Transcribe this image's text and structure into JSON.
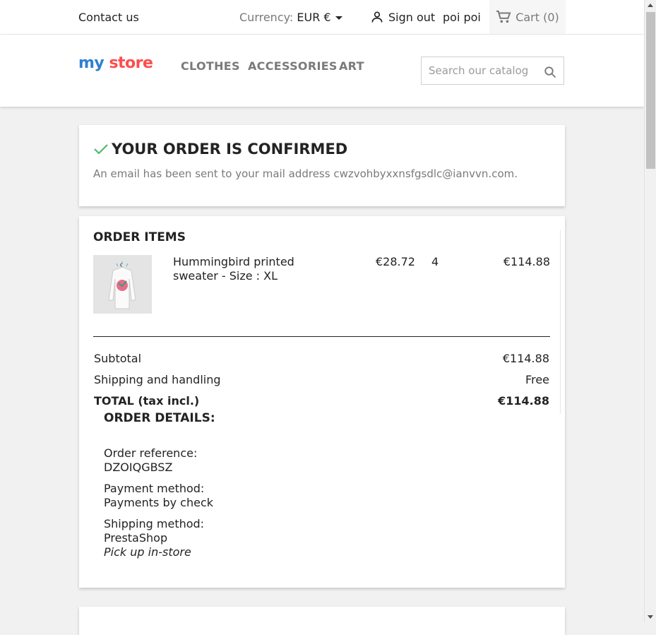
{
  "topbar": {
    "contact": "Contact us",
    "currency_label": "Currency:",
    "currency_value": "EUR €",
    "sign_out": "Sign out",
    "username": "poi poi",
    "cart": "Cart (0)"
  },
  "header": {
    "logo": {
      "part1": "my",
      "part2": "store"
    },
    "menu": [
      "CLOTHES",
      "ACCESSORIES",
      "ART"
    ],
    "search_placeholder": "Search our catalog"
  },
  "confirmation": {
    "title": "YOUR ORDER IS CONFIRMED",
    "message": "An email has been sent to your mail address cwzvohbyxxnsfgsdlc@ianvvn.com."
  },
  "order_items": {
    "heading": "ORDER ITEMS",
    "items": [
      {
        "name": "Hummingbird printed sweater - Size : XL",
        "unit_price": "€28.72",
        "quantity": "4",
        "total": "€114.88"
      }
    ],
    "subtotal_label": "Subtotal",
    "subtotal_value": "€114.88",
    "shipping_label": "Shipping and handling",
    "shipping_value": "Free",
    "total_label": "TOTAL (tax incl.)",
    "total_value": "€114.88"
  },
  "order_details": {
    "heading": "ORDER DETAILS:",
    "reference_label": "Order reference:",
    "reference_value": "DZOIQGBSZ",
    "payment_label": "Payment method:",
    "payment_value": "Payments by check",
    "shipping_label": "Shipping method:",
    "shipping_carrier": "PrestaShop",
    "shipping_note": "Pick up in-store"
  },
  "colors": {
    "check": "#4cbb6c",
    "logo_blue": "#2fb5d2",
    "logo_red": "#ff4c4c"
  }
}
